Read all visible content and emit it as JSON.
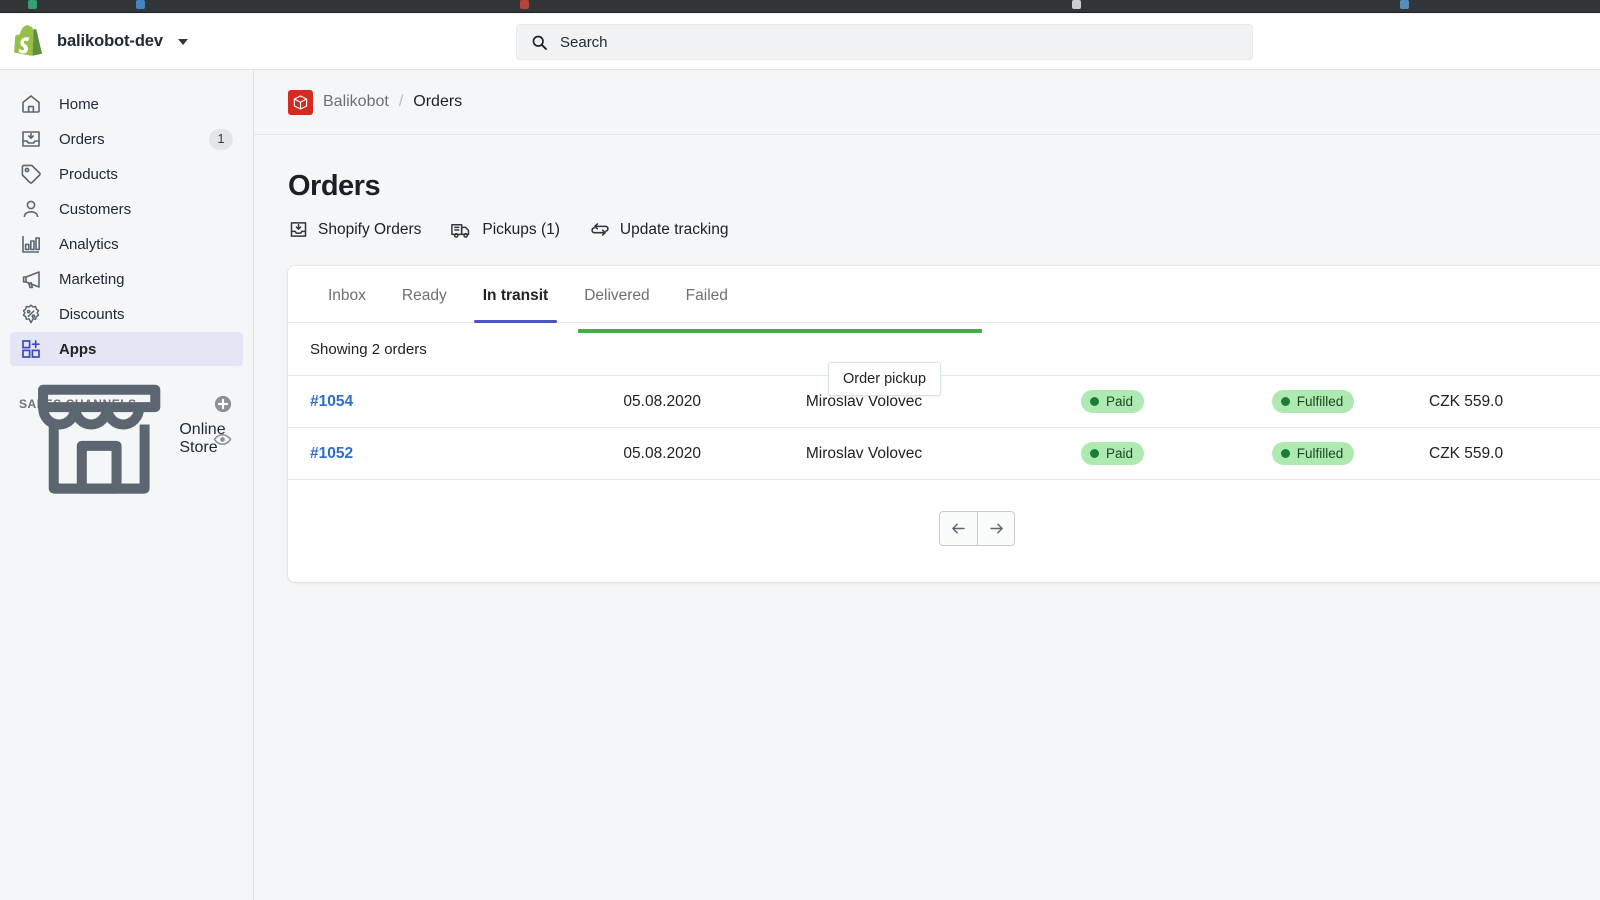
{
  "browser": {
    "tab_dot_colors": [
      "#35b37e",
      "#4a90d9",
      "#d0453b",
      "#b9bcbe",
      "#e8e8e8",
      "#5a9fd4"
    ]
  },
  "topbar": {
    "shop_name": "balikobot-dev",
    "shop_menu_icon": "chevron-down-icon",
    "logo_icon": "shopify-bag-icon",
    "search": {
      "icon": "search-icon",
      "placeholder": "Search",
      "value": ""
    }
  },
  "sidebar": {
    "items": [
      {
        "label": "Home",
        "icon": "home-icon",
        "badge": "",
        "active": false
      },
      {
        "label": "Orders",
        "icon": "orders-icon",
        "badge": "1",
        "active": false
      },
      {
        "label": "Products",
        "icon": "tag-icon",
        "badge": "",
        "active": false
      },
      {
        "label": "Customers",
        "icon": "person-icon",
        "badge": "",
        "active": false
      },
      {
        "label": "Analytics",
        "icon": "bar-chart-icon",
        "badge": "",
        "active": false
      },
      {
        "label": "Marketing",
        "icon": "megaphone-icon",
        "badge": "",
        "active": false
      },
      {
        "label": "Discounts",
        "icon": "discount-icon",
        "badge": "",
        "active": false
      },
      {
        "label": "Apps",
        "icon": "apps-plus-icon",
        "badge": "",
        "active": true
      }
    ],
    "sales_channels": {
      "title": "SALES CHANNELS",
      "add_icon": "plus-circle-icon",
      "channels": [
        {
          "label": "Online Store",
          "icon": "storefront-icon",
          "action_icon": "eye-icon"
        }
      ]
    }
  },
  "breadcrumb": {
    "app_icon": "balikobot-cube-icon",
    "app_name": "Balikobot",
    "separator": "/",
    "current": "Orders"
  },
  "main": {
    "title": "Orders",
    "actions": [
      {
        "label": "Shopify Orders",
        "icon": "import-orders-icon"
      },
      {
        "label": "Pickups (1)",
        "icon": "truck-icon"
      },
      {
        "label": "Update tracking",
        "icon": "refresh-arrows-icon"
      }
    ],
    "tabs": [
      {
        "label": "Inbox",
        "active": false
      },
      {
        "label": "Ready",
        "active": false
      },
      {
        "label": "In transit",
        "active": true
      },
      {
        "label": "Delivered",
        "active": false
      },
      {
        "label": "Failed",
        "active": false
      }
    ],
    "showing_text": "Showing 2 orders",
    "progress_color": "#3eb044",
    "tooltip": {
      "text": "Order pickup"
    },
    "orders": [
      {
        "id": "#1054",
        "date": "05.08.2020",
        "customer": "Miroslav Volovec",
        "payment_status": "Paid",
        "fulfillment_status": "Fulfilled",
        "total": "CZK 559.0"
      },
      {
        "id": "#1052",
        "date": "05.08.2020",
        "customer": "Miroslav Volovec",
        "payment_status": "Paid",
        "fulfillment_status": "Fulfilled",
        "total": "CZK 559.0"
      }
    ],
    "pagination": {
      "prev_icon": "arrow-left-icon",
      "next_icon": "arrow-right-icon"
    }
  },
  "colors": {
    "accent_indigo": "#4b56c4",
    "link_blue": "#2c6ecb",
    "badge_green_bg": "#aee9b1",
    "badge_green_dot": "#1a7e32",
    "brand_red": "#d42a1f",
    "progress_green": "#3eb044"
  }
}
